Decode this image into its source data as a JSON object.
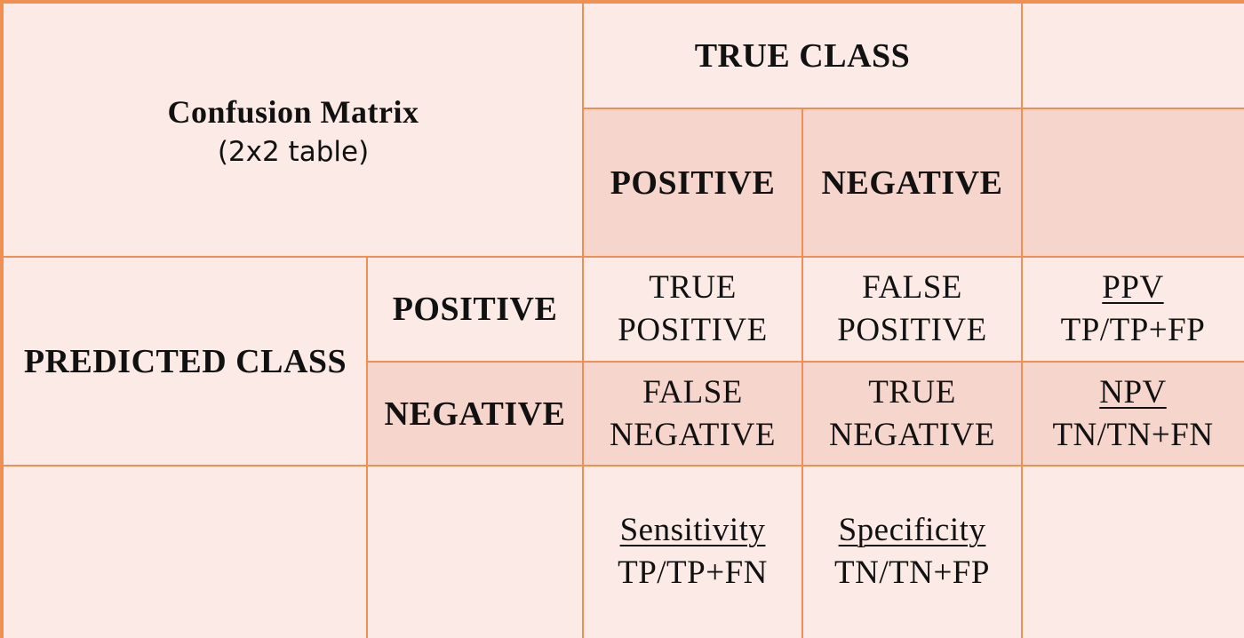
{
  "colors": {
    "border": "#ef8f52",
    "light_fill": "#fbeae5",
    "dark_fill": "#f6d6cc",
    "text": "#111111"
  },
  "title": {
    "main": "Confusion Matrix",
    "sub": "(2x2 table)"
  },
  "true_class": {
    "label": "TRUE CLASS",
    "positive": "POSITIVE",
    "negative": "NEGATIVE"
  },
  "predicted_class": {
    "label": "PREDICTED CLASS",
    "positive": "POSITIVE",
    "negative": "NEGATIVE"
  },
  "cells": {
    "tp": [
      "TRUE",
      "POSITIVE"
    ],
    "fp": [
      "FALSE",
      "POSITIVE"
    ],
    "fn": [
      "FALSE",
      "NEGATIVE"
    ],
    "tn": [
      "TRUE",
      "NEGATIVE"
    ]
  },
  "metrics": {
    "ppv": {
      "name": "PPV",
      "formula": "TP/TP+FP"
    },
    "npv": {
      "name": "NPV",
      "formula": "TN/TN+FN"
    },
    "sensitivity": {
      "name": "Sensitivity",
      "formula": "TP/TP+FN"
    },
    "specificity": {
      "name": "Specificity",
      "formula": "TN/TN+FP"
    }
  }
}
